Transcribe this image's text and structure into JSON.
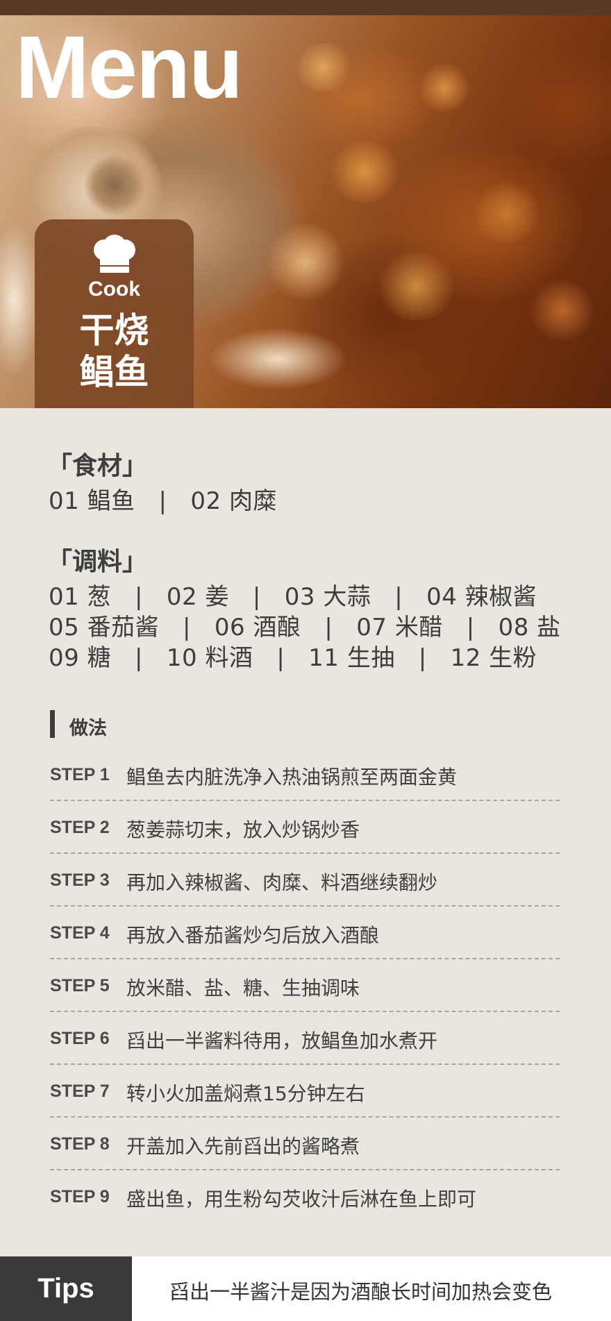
{
  "header": {
    "title": "Menu",
    "badge_cook": "Cook",
    "dish_line1": "干烧",
    "dish_line2": "鲳鱼",
    "chef_icon": "chef-hat-icon"
  },
  "ingredients": {
    "heading": "「食材」",
    "line": "01 鲳鱼   |   02 肉糜"
  },
  "seasonings": {
    "heading": "「调料」",
    "lines": [
      "01 葱   |   02 姜   |   03 大蒜   |   04 辣椒酱",
      "05 番茄酱   |   06 酒酿   |   07 米醋   |   08 盐",
      "09 糖   |   10 料酒   |   11 生抽   |   12 生粉"
    ]
  },
  "method": {
    "heading": "做法",
    "steps": [
      {
        "label": "STEP 1",
        "text": "鲳鱼去内脏洗净入热油锅煎至两面金黄"
      },
      {
        "label": "STEP 2",
        "text": "葱姜蒜切末，放入炒锅炒香"
      },
      {
        "label": "STEP 3",
        "text": "再加入辣椒酱、肉糜、料酒继续翻炒"
      },
      {
        "label": "STEP 4",
        "text": "再放入番茄酱炒匀后放入酒酿"
      },
      {
        "label": "STEP 5",
        "text": "放米醋、盐、糖、生抽调味"
      },
      {
        "label": "STEP 6",
        "text": "舀出一半酱料待用，放鲳鱼加水煮开"
      },
      {
        "label": "STEP 7",
        "text": "转小火加盖焖煮15分钟左右"
      },
      {
        "label": "STEP 8",
        "text": "开盖加入先前舀出的酱略煮"
      },
      {
        "label": "STEP 9",
        "text": "盛出鱼，用生粉勾芡收汁后淋在鱼上即可"
      }
    ]
  },
  "tips": {
    "label": "Tips",
    "text": "舀出一半酱汁是因为酒酿长时间加热会变色"
  }
}
